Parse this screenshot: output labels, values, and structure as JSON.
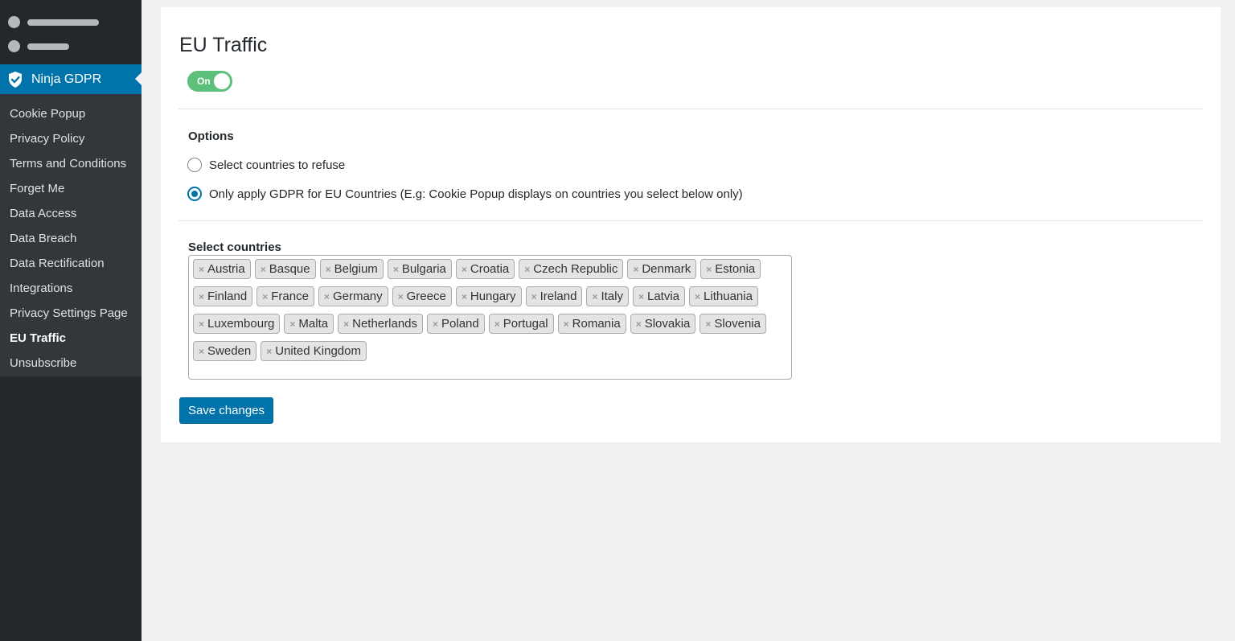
{
  "sidebar": {
    "active_menu": {
      "label": "Ninja GDPR",
      "icon": "shield-check-icon"
    },
    "submenu": [
      {
        "label": "Cookie Popup",
        "current": false
      },
      {
        "label": "Privacy Policy",
        "current": false
      },
      {
        "label": "Terms and Conditions",
        "current": false
      },
      {
        "label": "Forget Me",
        "current": false
      },
      {
        "label": "Data Access",
        "current": false
      },
      {
        "label": "Data Breach",
        "current": false
      },
      {
        "label": "Data Rectification",
        "current": false
      },
      {
        "label": "Integrations",
        "current": false
      },
      {
        "label": "Privacy Settings Page",
        "current": false
      },
      {
        "label": "EU Traffic",
        "current": true
      },
      {
        "label": "Unsubscribe",
        "current": false
      }
    ]
  },
  "page": {
    "title": "EU Traffic",
    "toggle": {
      "label": "On",
      "state": true
    },
    "options": {
      "label": "Options",
      "radios": [
        {
          "label": "Select countries to refuse",
          "checked": false
        },
        {
          "label": "Only apply GDPR for EU Countries (E.g: Cookie Popup displays on countries you select below only)",
          "checked": true
        }
      ]
    },
    "countries": {
      "label": "Select countries",
      "remove_glyph": "×",
      "selected": [
        "Austria",
        "Basque",
        "Belgium",
        "Bulgaria",
        "Croatia",
        "Czech Republic",
        "Denmark",
        "Estonia",
        "Finland",
        "France",
        "Germany",
        "Greece",
        "Hungary",
        "Ireland",
        "Italy",
        "Latvia",
        "Lithuania",
        "Luxembourg",
        "Malta",
        "Netherlands",
        "Poland",
        "Portugal",
        "Romania",
        "Slovakia",
        "Slovenia",
        "Sweden",
        "United Kingdom"
      ]
    },
    "save_label": "Save changes"
  },
  "colors": {
    "accent": "#0073aa",
    "toggle_on": "#5cbf7a",
    "sidebar_bg": "#23282d",
    "submenu_bg": "#32373c"
  }
}
